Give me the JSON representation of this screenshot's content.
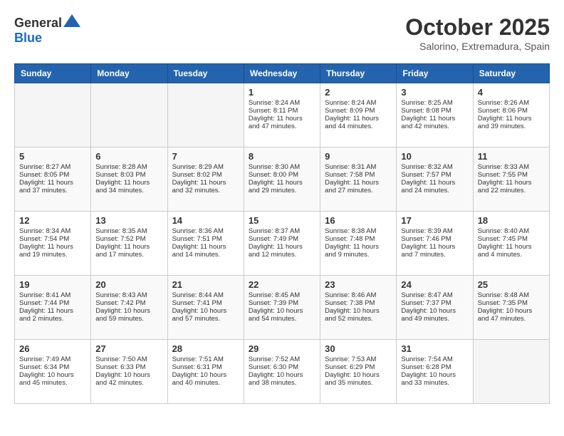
{
  "header": {
    "logo_general": "General",
    "logo_blue": "Blue",
    "month": "October 2025",
    "location": "Salorino, Extremadura, Spain"
  },
  "weekdays": [
    "Sunday",
    "Monday",
    "Tuesday",
    "Wednesday",
    "Thursday",
    "Friday",
    "Saturday"
  ],
  "weeks": [
    [
      {
        "day": "",
        "sunrise": "",
        "sunset": "",
        "daylight": "",
        "empty": true
      },
      {
        "day": "",
        "sunrise": "",
        "sunset": "",
        "daylight": "",
        "empty": true
      },
      {
        "day": "",
        "sunrise": "",
        "sunset": "",
        "daylight": "",
        "empty": true
      },
      {
        "day": "1",
        "sunrise": "Sunrise: 8:24 AM",
        "sunset": "Sunset: 8:11 PM",
        "daylight": "Daylight: 11 hours and 47 minutes."
      },
      {
        "day": "2",
        "sunrise": "Sunrise: 8:24 AM",
        "sunset": "Sunset: 8:09 PM",
        "daylight": "Daylight: 11 hours and 44 minutes."
      },
      {
        "day": "3",
        "sunrise": "Sunrise: 8:25 AM",
        "sunset": "Sunset: 8:08 PM",
        "daylight": "Daylight: 11 hours and 42 minutes."
      },
      {
        "day": "4",
        "sunrise": "Sunrise: 8:26 AM",
        "sunset": "Sunset: 8:06 PM",
        "daylight": "Daylight: 11 hours and 39 minutes."
      }
    ],
    [
      {
        "day": "5",
        "sunrise": "Sunrise: 8:27 AM",
        "sunset": "Sunset: 8:05 PM",
        "daylight": "Daylight: 11 hours and 37 minutes."
      },
      {
        "day": "6",
        "sunrise": "Sunrise: 8:28 AM",
        "sunset": "Sunset: 8:03 PM",
        "daylight": "Daylight: 11 hours and 34 minutes."
      },
      {
        "day": "7",
        "sunrise": "Sunrise: 8:29 AM",
        "sunset": "Sunset: 8:02 PM",
        "daylight": "Daylight: 11 hours and 32 minutes."
      },
      {
        "day": "8",
        "sunrise": "Sunrise: 8:30 AM",
        "sunset": "Sunset: 8:00 PM",
        "daylight": "Daylight: 11 hours and 29 minutes."
      },
      {
        "day": "9",
        "sunrise": "Sunrise: 8:31 AM",
        "sunset": "Sunset: 7:58 PM",
        "daylight": "Daylight: 11 hours and 27 minutes."
      },
      {
        "day": "10",
        "sunrise": "Sunrise: 8:32 AM",
        "sunset": "Sunset: 7:57 PM",
        "daylight": "Daylight: 11 hours and 24 minutes."
      },
      {
        "day": "11",
        "sunrise": "Sunrise: 8:33 AM",
        "sunset": "Sunset: 7:55 PM",
        "daylight": "Daylight: 11 hours and 22 minutes."
      }
    ],
    [
      {
        "day": "12",
        "sunrise": "Sunrise: 8:34 AM",
        "sunset": "Sunset: 7:54 PM",
        "daylight": "Daylight: 11 hours and 19 minutes."
      },
      {
        "day": "13",
        "sunrise": "Sunrise: 8:35 AM",
        "sunset": "Sunset: 7:52 PM",
        "daylight": "Daylight: 11 hours and 17 minutes."
      },
      {
        "day": "14",
        "sunrise": "Sunrise: 8:36 AM",
        "sunset": "Sunset: 7:51 PM",
        "daylight": "Daylight: 11 hours and 14 minutes."
      },
      {
        "day": "15",
        "sunrise": "Sunrise: 8:37 AM",
        "sunset": "Sunset: 7:49 PM",
        "daylight": "Daylight: 11 hours and 12 minutes."
      },
      {
        "day": "16",
        "sunrise": "Sunrise: 8:38 AM",
        "sunset": "Sunset: 7:48 PM",
        "daylight": "Daylight: 11 hours and 9 minutes."
      },
      {
        "day": "17",
        "sunrise": "Sunrise: 8:39 AM",
        "sunset": "Sunset: 7:46 PM",
        "daylight": "Daylight: 11 hours and 7 minutes."
      },
      {
        "day": "18",
        "sunrise": "Sunrise: 8:40 AM",
        "sunset": "Sunset: 7:45 PM",
        "daylight": "Daylight: 11 hours and 4 minutes."
      }
    ],
    [
      {
        "day": "19",
        "sunrise": "Sunrise: 8:41 AM",
        "sunset": "Sunset: 7:44 PM",
        "daylight": "Daylight: 11 hours and 2 minutes."
      },
      {
        "day": "20",
        "sunrise": "Sunrise: 8:43 AM",
        "sunset": "Sunset: 7:42 PM",
        "daylight": "Daylight: 10 hours and 59 minutes."
      },
      {
        "day": "21",
        "sunrise": "Sunrise: 8:44 AM",
        "sunset": "Sunset: 7:41 PM",
        "daylight": "Daylight: 10 hours and 57 minutes."
      },
      {
        "day": "22",
        "sunrise": "Sunrise: 8:45 AM",
        "sunset": "Sunset: 7:39 PM",
        "daylight": "Daylight: 10 hours and 54 minutes."
      },
      {
        "day": "23",
        "sunrise": "Sunrise: 8:46 AM",
        "sunset": "Sunset: 7:38 PM",
        "daylight": "Daylight: 10 hours and 52 minutes."
      },
      {
        "day": "24",
        "sunrise": "Sunrise: 8:47 AM",
        "sunset": "Sunset: 7:37 PM",
        "daylight": "Daylight: 10 hours and 49 minutes."
      },
      {
        "day": "25",
        "sunrise": "Sunrise: 8:48 AM",
        "sunset": "Sunset: 7:35 PM",
        "daylight": "Daylight: 10 hours and 47 minutes."
      }
    ],
    [
      {
        "day": "26",
        "sunrise": "Sunrise: 7:49 AM",
        "sunset": "Sunset: 6:34 PM",
        "daylight": "Daylight: 10 hours and 45 minutes."
      },
      {
        "day": "27",
        "sunrise": "Sunrise: 7:50 AM",
        "sunset": "Sunset: 6:33 PM",
        "daylight": "Daylight: 10 hours and 42 minutes."
      },
      {
        "day": "28",
        "sunrise": "Sunrise: 7:51 AM",
        "sunset": "Sunset: 6:31 PM",
        "daylight": "Daylight: 10 hours and 40 minutes."
      },
      {
        "day": "29",
        "sunrise": "Sunrise: 7:52 AM",
        "sunset": "Sunset: 6:30 PM",
        "daylight": "Daylight: 10 hours and 38 minutes."
      },
      {
        "day": "30",
        "sunrise": "Sunrise: 7:53 AM",
        "sunset": "Sunset: 6:29 PM",
        "daylight": "Daylight: 10 hours and 35 minutes."
      },
      {
        "day": "31",
        "sunrise": "Sunrise: 7:54 AM",
        "sunset": "Sunset: 6:28 PM",
        "daylight": "Daylight: 10 hours and 33 minutes."
      },
      {
        "day": "",
        "sunrise": "",
        "sunset": "",
        "daylight": "",
        "empty": true
      }
    ]
  ]
}
